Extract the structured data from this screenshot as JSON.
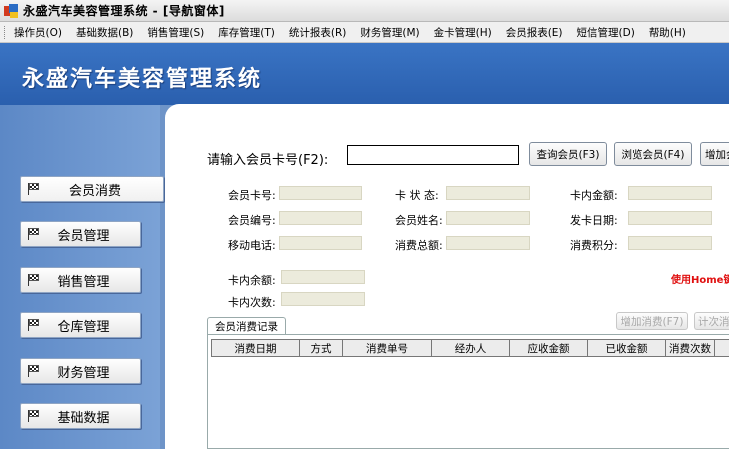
{
  "window": {
    "title": "永盛汽车美容管理系统 - [导航窗体]"
  },
  "menu": [
    "操作员(O)",
    "基础数据(B)",
    "销售管理(S)",
    "库存管理(T)",
    "统计报表(R)",
    "财务管理(M)",
    "金卡管理(H)",
    "会员报表(E)",
    "短信管理(D)",
    "帮助(H)"
  ],
  "banner": {
    "title": "永盛汽车美容管理系统"
  },
  "sidebar": {
    "items": [
      {
        "label": "会员消费",
        "icon": "checkered-flag-icon",
        "active": true
      },
      {
        "label": "会员管理",
        "icon": "checkered-flag-icon"
      },
      {
        "label": "销售管理",
        "icon": "checkered-flag-icon"
      },
      {
        "label": "仓库管理",
        "icon": "checkered-flag-icon"
      },
      {
        "label": "财务管理",
        "icon": "checkered-flag-icon"
      },
      {
        "label": "基础数据",
        "icon": "checkered-flag-icon"
      }
    ]
  },
  "search": {
    "label": "请输入会员卡号(F2):",
    "value": "",
    "query_button": "查询会员(F3)",
    "browse_button": "浏览会员(F4)",
    "add_button": "增加会"
  },
  "fields": {
    "card_no": "会员卡号:",
    "card_status": "卡 状 态:",
    "card_amount": "卡内金额:",
    "member_no": "会员编号:",
    "member_name": "会员姓名:",
    "issue_date": "发卡日期:",
    "mobile": "移动电话:",
    "total_spent": "消费总额:",
    "points": "消费积分:",
    "balance": "卡内余额:",
    "times": "卡内次数:"
  },
  "hint": "使用Home键",
  "records": {
    "tab": "会员消费记录",
    "add_button": "增加消费(F7)",
    "count_button": "计次消",
    "columns": [
      "消费日期",
      "方式",
      "消费单号",
      "经办人",
      "应收金额",
      "已收金额",
      "消费次数"
    ]
  },
  "colors": {
    "banner": "#2f67b5",
    "sidebar": "#6a96d0",
    "field": "#ecebdc",
    "hint": "#e01010"
  }
}
